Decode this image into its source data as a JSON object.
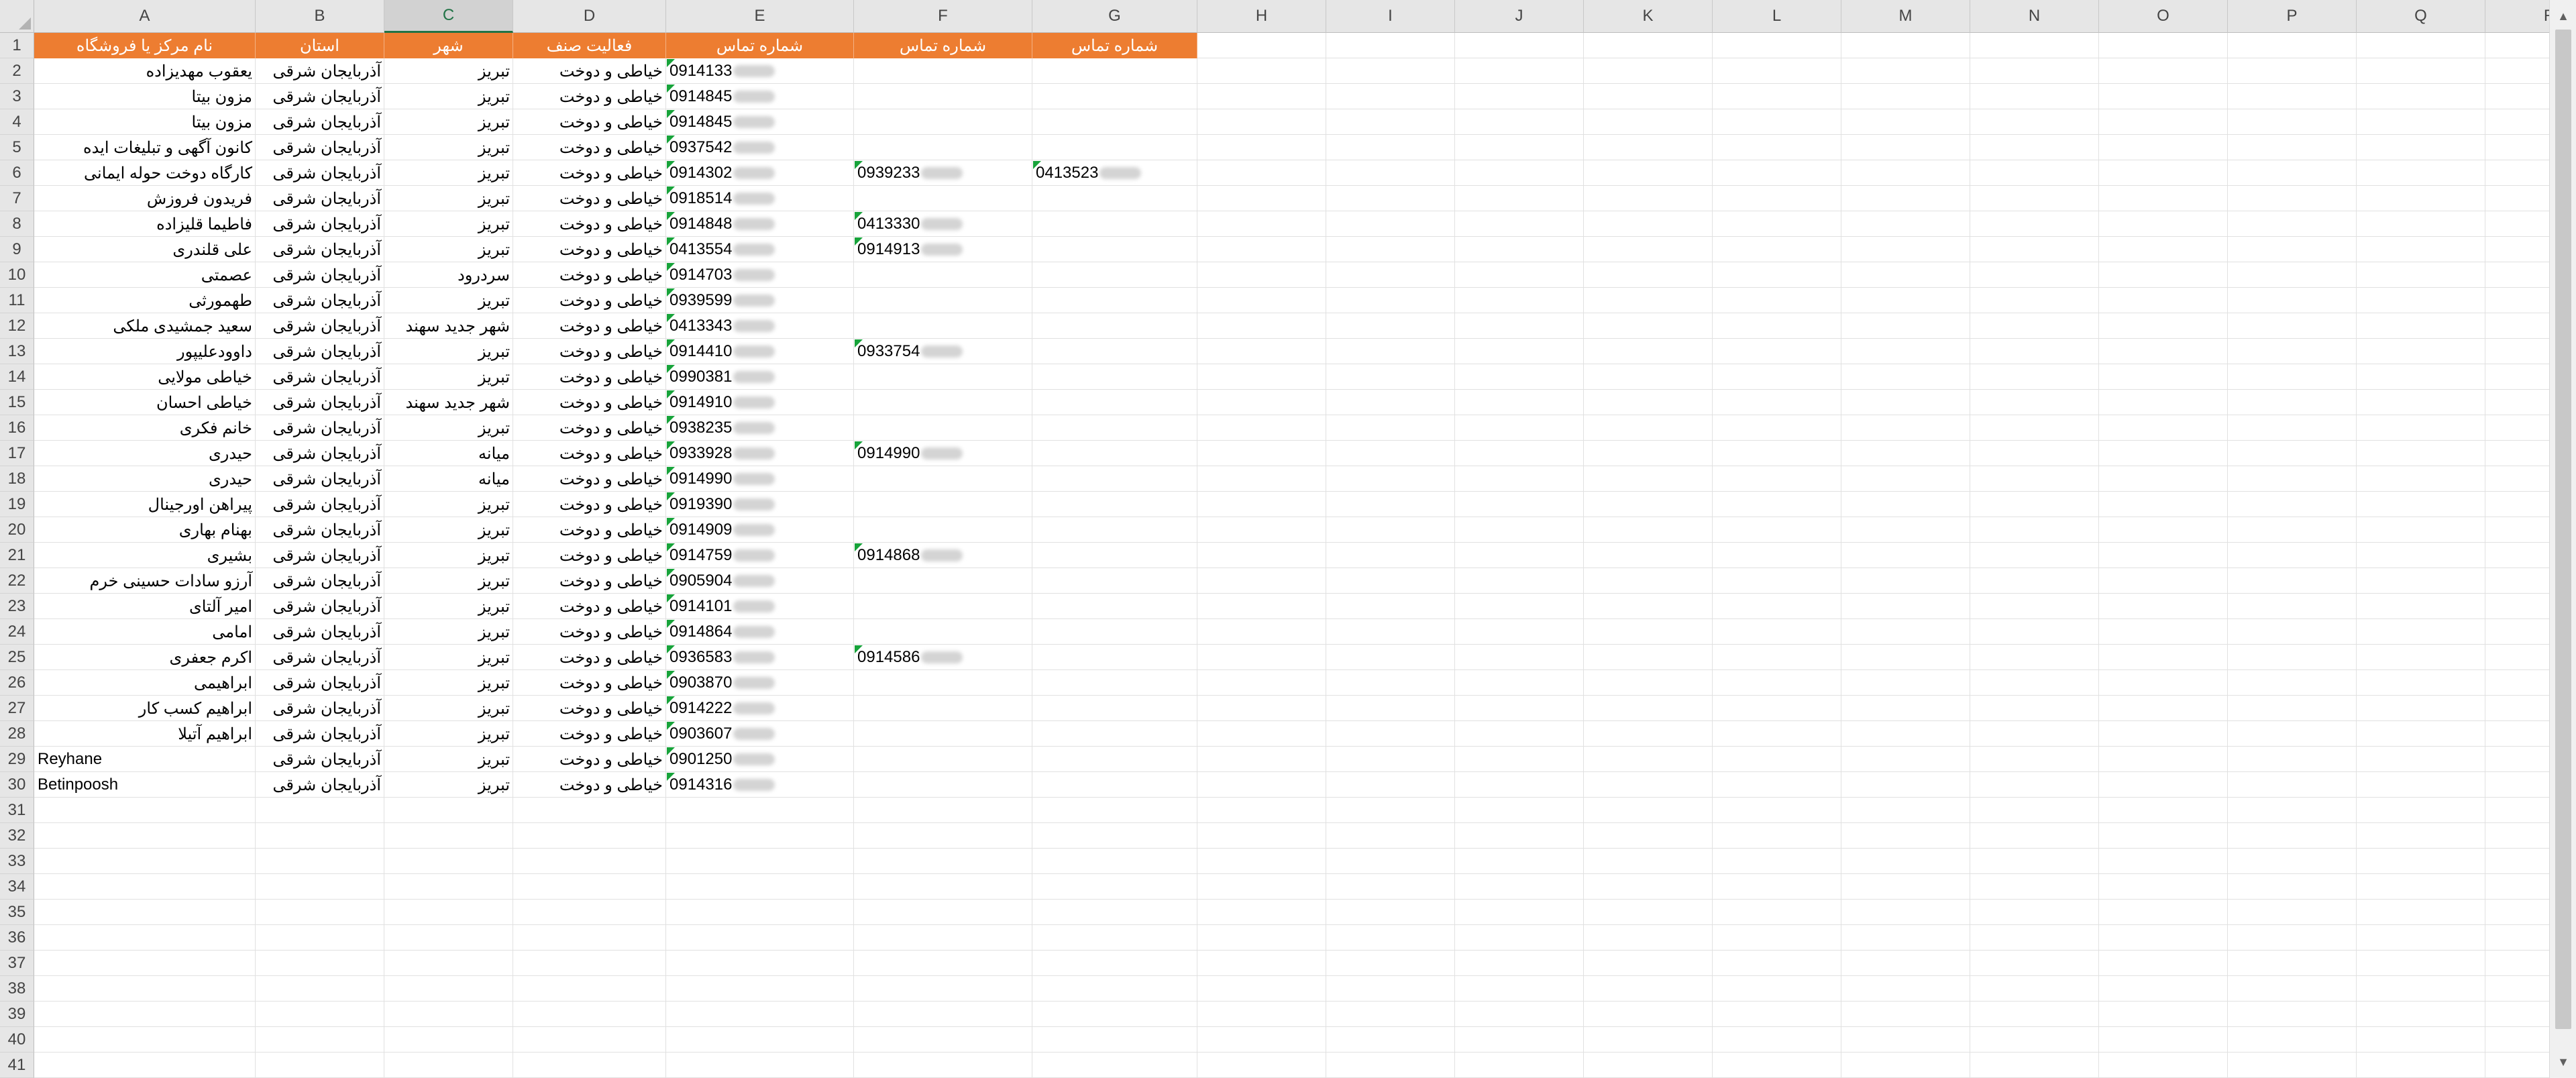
{
  "sheet": {
    "columns": [
      "A",
      "B",
      "C",
      "D",
      "E",
      "F",
      "G",
      "H",
      "I",
      "J",
      "K",
      "L",
      "M",
      "N",
      "O",
      "P",
      "Q",
      "R"
    ],
    "active_column": "C",
    "row_numbers": [
      "1",
      "2",
      "3",
      "4",
      "5",
      "6",
      "7",
      "8",
      "9",
      "10",
      "11",
      "12",
      "13",
      "14",
      "15",
      "16",
      "17",
      "18",
      "19",
      "20",
      "21",
      "22",
      "23",
      "24",
      "25",
      "26",
      "27",
      "28",
      "29",
      "30",
      "31",
      "32",
      "33",
      "34",
      "35",
      "36",
      "37",
      "38",
      "39",
      "40",
      "41"
    ],
    "headers": [
      "نام مرکز یا فروشگاه",
      "استان",
      "شهر",
      "فعالیت صنف",
      "شماره تماس",
      "شماره تماس",
      "شماره تماس"
    ],
    "rows": [
      {
        "name": "یعقوب مهدیزاده",
        "province": "آذربایجان شرقی",
        "city": "تبریز",
        "activity": "خیاطی و دوخت",
        "phone1": "0914133",
        "phone2": "",
        "phone3": ""
      },
      {
        "name": "مزون بیتا",
        "province": "آذربایجان شرقی",
        "city": "تبریز",
        "activity": "خیاطی و دوخت",
        "phone1": "0914845",
        "phone2": "",
        "phone3": ""
      },
      {
        "name": "مزون بیتا",
        "province": "آذربایجان شرقی",
        "city": "تبریز",
        "activity": "خیاطی و دوخت",
        "phone1": "0914845",
        "phone2": "",
        "phone3": ""
      },
      {
        "name": "کانون آگهی و تبلیغات ایده",
        "province": "آذربایجان شرقی",
        "city": "تبریز",
        "activity": "خیاطی و دوخت",
        "phone1": "0937542",
        "phone2": "",
        "phone3": ""
      },
      {
        "name": "کارگاه دوخت حوله ایمانی",
        "province": "آذربایجان شرقی",
        "city": "تبریز",
        "activity": "خیاطی و دوخت",
        "phone1": "0914302",
        "phone2": "0939233",
        "phone3": "0413523"
      },
      {
        "name": "فریدون فروزش",
        "province": "آذربایجان شرقی",
        "city": "تبریز",
        "activity": "خیاطی و دوخت",
        "phone1": "0918514",
        "phone2": "",
        "phone3": ""
      },
      {
        "name": "فاطیما قلیزاده",
        "province": "آذربایجان شرقی",
        "city": "تبریز",
        "activity": "خیاطی و دوخت",
        "phone1": "0914848",
        "phone2": "0413330",
        "phone3": ""
      },
      {
        "name": "علی قلندری",
        "province": "آذربایجان شرقی",
        "city": "تبریز",
        "activity": "خیاطی و دوخت",
        "phone1": "0413554",
        "phone2": "0914913",
        "phone3": ""
      },
      {
        "name": "عصمتی",
        "province": "آذربایجان شرقی",
        "city": "سردرود",
        "activity": "خیاطی و دوخت",
        "phone1": "0914703",
        "phone2": "",
        "phone3": ""
      },
      {
        "name": "طهمورثی",
        "province": "آذربایجان شرقی",
        "city": "تبریز",
        "activity": "خیاطی و دوخت",
        "phone1": "0939599",
        "phone2": "",
        "phone3": ""
      },
      {
        "name": "سعید جمشیدی ملکی",
        "province": "آذربایجان شرقی",
        "city": "شهر جدید سهند",
        "activity": "خیاطی و دوخت",
        "phone1": "0413343",
        "phone2": "",
        "phone3": ""
      },
      {
        "name": "داوودعلیپور",
        "province": "آذربایجان شرقی",
        "city": "تبریز",
        "activity": "خیاطی و دوخت",
        "phone1": "0914410",
        "phone2": "0933754",
        "phone3": ""
      },
      {
        "name": "خیاطی مولایی",
        "province": "آذربایجان شرقی",
        "city": "تبریز",
        "activity": "خیاطی و دوخت",
        "phone1": "0990381",
        "phone2": "",
        "phone3": ""
      },
      {
        "name": "خیاطی احسان",
        "province": "آذربایجان شرقی",
        "city": "شهر جدید سهند",
        "activity": "خیاطی و دوخت",
        "phone1": "0914910",
        "phone2": "",
        "phone3": ""
      },
      {
        "name": "خانم فکری",
        "province": "آذربایجان شرقی",
        "city": "تبریز",
        "activity": "خیاطی و دوخت",
        "phone1": "0938235",
        "phone2": "",
        "phone3": ""
      },
      {
        "name": "حیدری",
        "province": "آذربایجان شرقی",
        "city": "میانه",
        "activity": "خیاطی و دوخت",
        "phone1": "0933928",
        "phone2": "0914990",
        "phone3": ""
      },
      {
        "name": "حیدری",
        "province": "آذربایجان شرقی",
        "city": "میانه",
        "activity": "خیاطی و دوخت",
        "phone1": "0914990",
        "phone2": "",
        "phone3": ""
      },
      {
        "name": "پیراهن اورجینال",
        "province": "آذربایجان شرقی",
        "city": "تبریز",
        "activity": "خیاطی و دوخت",
        "phone1": "0919390",
        "phone2": "",
        "phone3": ""
      },
      {
        "name": "بهنام بهاری",
        "province": "آذربایجان شرقی",
        "city": "تبریز",
        "activity": "خیاطی و دوخت",
        "phone1": "0914909",
        "phone2": "",
        "phone3": ""
      },
      {
        "name": "بشیری",
        "province": "آذربایجان شرقی",
        "city": "تبریز",
        "activity": "خیاطی و دوخت",
        "phone1": "0914759",
        "phone2": "0914868",
        "phone3": ""
      },
      {
        "name": "آرزو سادات حسینی خرم",
        "province": "آذربایجان شرقی",
        "city": "تبریز",
        "activity": "خیاطی و دوخت",
        "phone1": "0905904",
        "phone2": "",
        "phone3": ""
      },
      {
        "name": "امیر آلتای",
        "province": "آذربایجان شرقی",
        "city": "تبریز",
        "activity": "خیاطی و دوخت",
        "phone1": "0914101",
        "phone2": "",
        "phone3": ""
      },
      {
        "name": "امامی",
        "province": "آذربایجان شرقی",
        "city": "تبریز",
        "activity": "خیاطی و دوخت",
        "phone1": "0914864",
        "phone2": "",
        "phone3": ""
      },
      {
        "name": "اکرم جعفری",
        "province": "آذربایجان شرقی",
        "city": "تبریز",
        "activity": "خیاطی و دوخت",
        "phone1": "0936583",
        "phone2": "0914586",
        "phone3": ""
      },
      {
        "name": "ابراهیمی",
        "province": "آذربایجان شرقی",
        "city": "تبریز",
        "activity": "خیاطی و دوخت",
        "phone1": "0903870",
        "phone2": "",
        "phone3": ""
      },
      {
        "name": "ابراهیم کسب کار",
        "province": "آذربایجان شرقی",
        "city": "تبریز",
        "activity": "خیاطی و دوخت",
        "phone1": "0914222",
        "phone2": "",
        "phone3": ""
      },
      {
        "name": "ابراهیم آتیلا",
        "province": "آذربایجان شرقی",
        "city": "تبریز",
        "activity": "خیاطی و دوخت",
        "phone1": "0903607",
        "phone2": "",
        "phone3": ""
      },
      {
        "name": "Reyhane",
        "province": "آذربایجان شرقی",
        "city": "تبریز",
        "activity": "خیاطی و دوخت",
        "phone1": "0901250",
        "phone2": "",
        "phone3": ""
      },
      {
        "name": "Betinpoosh",
        "province": "آذربایجان شرقی",
        "city": "تبریز",
        "activity": "خیاطی و دوخت",
        "phone1": "0914316",
        "phone2": "",
        "phone3": ""
      }
    ]
  },
  "scrollbar": {
    "up_icon": "▲",
    "down_icon": "▼"
  },
  "colors": {
    "header_fill": "#ed7d31",
    "header_text": "#ffffff",
    "number_as_text_flag": "#17a33a"
  }
}
